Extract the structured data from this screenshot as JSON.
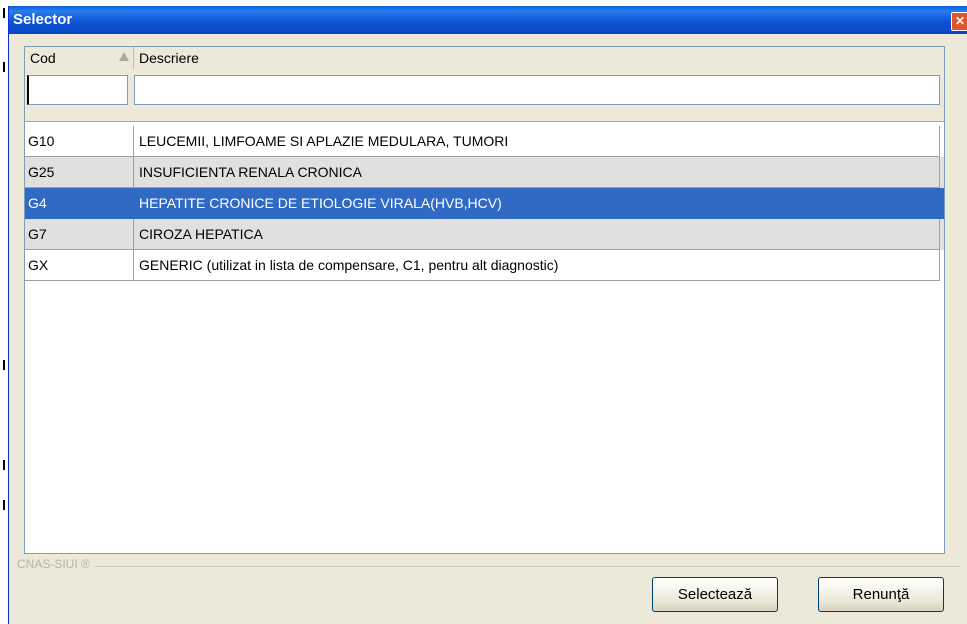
{
  "window": {
    "title": "Selector"
  },
  "grid": {
    "columns": [
      {
        "label": "Cod"
      },
      {
        "label": "Descriere"
      }
    ],
    "filter_cod": "",
    "filter_descriere": "",
    "rows": [
      {
        "cod": "G10",
        "descriere": "LEUCEMII, LIMFOAME SI APLAZIE MEDULARA, TUMORI"
      },
      {
        "cod": "G25",
        "descriere": "INSUFICIENTA RENALA CRONICA"
      },
      {
        "cod": "G4",
        "descriere": "HEPATITE CRONICE DE ETIOLOGIE VIRALA(HVB,HCV)"
      },
      {
        "cod": "G7",
        "descriere": "CIROZA HEPATICA"
      },
      {
        "cod": "GX",
        "descriere": "GENERIC (utilizat in lista de compensare, C1, pentru alt diagnostic)"
      }
    ],
    "selected_row": "G4"
  },
  "footer": {
    "group_label": "CNAS-SIUI ®",
    "select_label": "Selectează",
    "cancel_label": "Renunţă"
  },
  "colors": {
    "title_bar": "#0a5fd8",
    "selection": "#316ac5",
    "alt_row": "#e0e0e0",
    "close_button": "#e0552e"
  },
  "icons": {
    "close": "close-icon",
    "sort": "sort-ascending-icon"
  }
}
